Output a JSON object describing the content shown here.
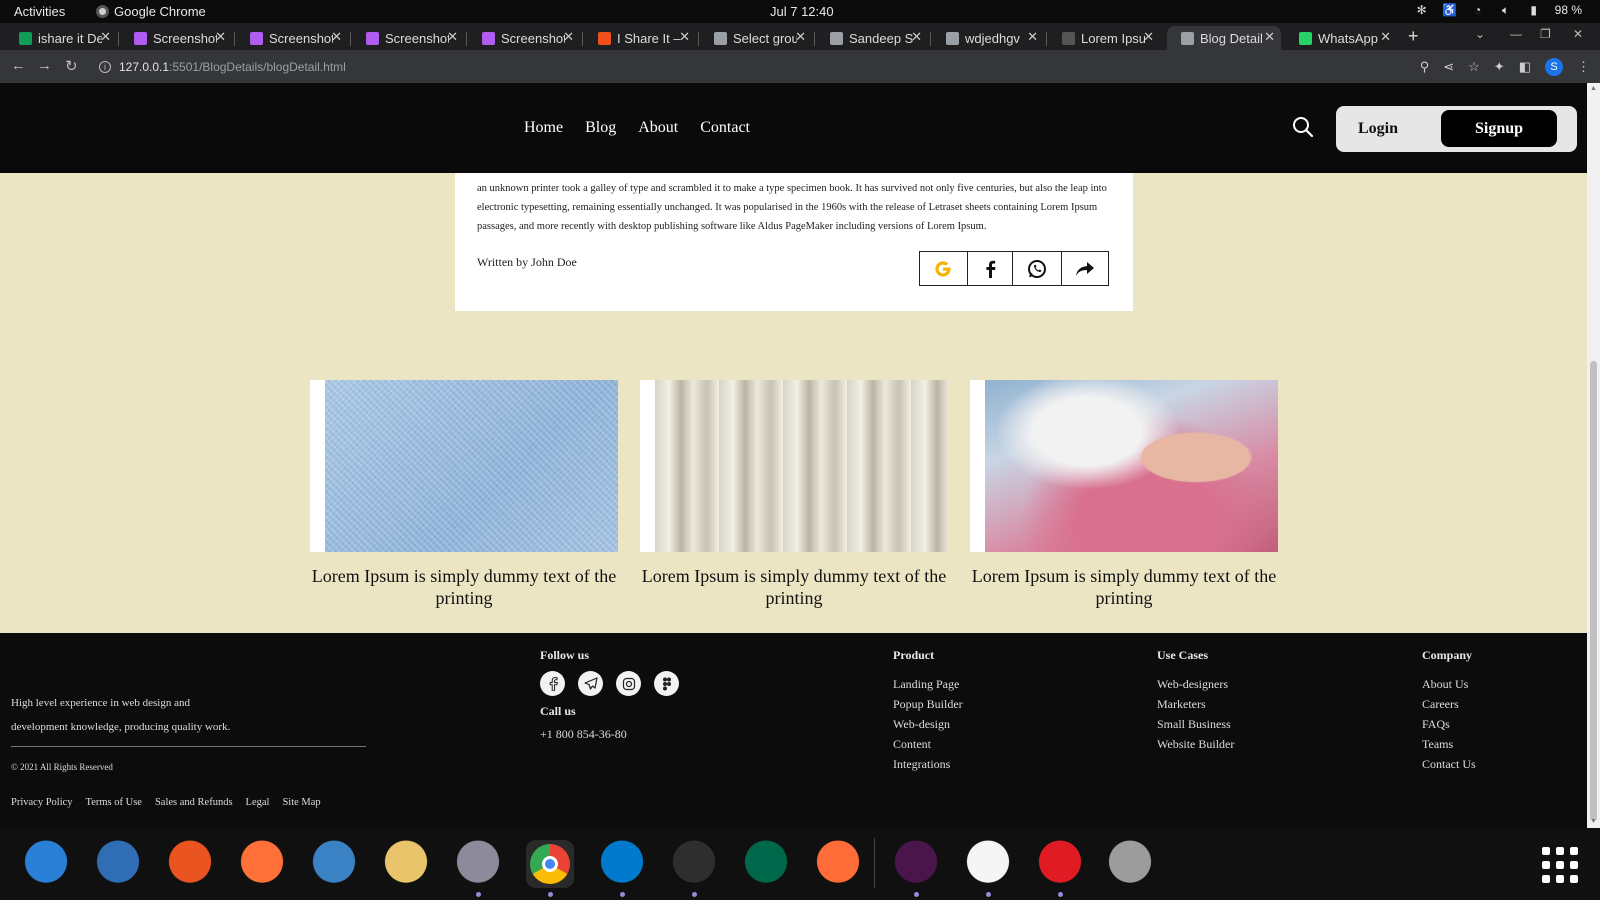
{
  "system_bar": {
    "activities": "Activities",
    "app_name": "Google Chrome",
    "clock": "Jul 7  12:40",
    "battery": "98 %"
  },
  "tabs": [
    {
      "title": "ishare it De",
      "color": "#0f9d58"
    },
    {
      "title": "Screenshot",
      "color": "#b05cf0"
    },
    {
      "title": "Screenshot",
      "color": "#b05cf0"
    },
    {
      "title": "Screenshot",
      "color": "#b05cf0"
    },
    {
      "title": "Screenshot",
      "color": "#b05cf0"
    },
    {
      "title": "I Share It –",
      "color": "#f24e1e"
    },
    {
      "title": "Select grou",
      "color": "#9aa0a6"
    },
    {
      "title": "Sandeep S",
      "color": "#9aa0a6"
    },
    {
      "title": "wdjedhgv",
      "color": "#9aa0a6"
    },
    {
      "title": "Lorem Ipsu",
      "color": "#555555"
    },
    {
      "title": "Blog Detail",
      "color": "#9aa0a6"
    },
    {
      "title": "WhatsApp",
      "color": "#25d366"
    }
  ],
  "active_tab_index": 10,
  "address_bar": {
    "url_host": "127.0.0.1",
    "url_path": ":5501/BlogDetails/blogDetail.html",
    "profile_initial": "S"
  },
  "site_nav": {
    "links": [
      "Home",
      "Blog",
      "About",
      "Contact"
    ],
    "login": "Login",
    "signup": "Signup"
  },
  "article": {
    "body": "an unknown printer took a galley of type and scrambled it to make a type specimen book. It has survived not only five centuries, but also the leap into electronic typesetting, remaining essentially unchanged. It was popularised in the 1960s with the release of Letraset sheets containing Lorem Ipsum passages, and more recently with desktop publishing software like Aldus PageMaker including versions of Lorem Ipsum.",
    "author": "Written by John Doe",
    "share_icons": [
      "google-icon",
      "facebook-icon",
      "whatsapp-icon",
      "share-arrow-icon"
    ]
  },
  "cards": [
    {
      "caption": "Lorem Ipsum is simply dummy text of the printing",
      "image": "denim-fabric"
    },
    {
      "caption": "Lorem Ipsum is simply dummy text of the printing",
      "image": "white-drape-fabric"
    },
    {
      "caption": "Lorem Ipsum is simply dummy text of the printing",
      "image": "sewing-machine"
    }
  ],
  "footer": {
    "about": "High level experience in web design and development knowledge, producing quality work.",
    "copyright": "© 2021 All Rights Reserved",
    "legal_links": [
      "Privacy Policy",
      "Terms of Use",
      "Sales and Refunds",
      "Legal",
      "Site Map"
    ],
    "follow_title": "Follow us",
    "social_icons": [
      "facebook-icon",
      "telegram-icon",
      "instagram-icon",
      "figma-icon"
    ],
    "call_title": "Call us",
    "phone": "+1 800 854-36-80",
    "columns": [
      {
        "title": "Product",
        "items": [
          "Landing Page",
          "Popup Builder",
          "Web-design",
          "Content",
          "Integrations"
        ]
      },
      {
        "title": "Use Cases",
        "items": [
          "Web-designers",
          "Marketers",
          "Small Business",
          "Website Builder"
        ]
      },
      {
        "title": "Company",
        "items": [
          "About Us",
          "Careers",
          "FAQs",
          "Teams",
          "Contact Us"
        ]
      }
    ]
  },
  "dock": [
    {
      "name": "help-app-icon",
      "color": "#2a7fd6",
      "indicator": false
    },
    {
      "name": "writer-app-icon",
      "color": "#2f6db5",
      "indicator": false
    },
    {
      "name": "software-center-app-icon",
      "color": "#e95420",
      "indicator": false
    },
    {
      "name": "firefox-app-icon",
      "color": "#ff7139",
      "indicator": false
    },
    {
      "name": "thunderbird-app-icon",
      "color": "#3b82c4",
      "indicator": false
    },
    {
      "name": "rhythmbox-app-icon",
      "color": "#e9c46a",
      "indicator": false
    },
    {
      "name": "files-app-icon",
      "color": "#8d8a9c",
      "indicator": true
    },
    {
      "name": "chrome-app-icon",
      "color": "#4285f4",
      "indicator": true
    },
    {
      "name": "vscode-app-icon",
      "color": "#007acc",
      "indicator": true
    },
    {
      "name": "terminal-app-icon",
      "color": "#2e2e2e",
      "indicator": true
    },
    {
      "name": "mongodb-compass-app-icon",
      "color": "#00684a",
      "indicator": false
    },
    {
      "name": "postman-app-icon",
      "color": "#ff6c37",
      "indicator": false
    },
    {
      "name": "slack-app-icon",
      "color": "#4a154b",
      "indicator": true
    },
    {
      "name": "text-editor-app-icon",
      "color": "#f5f5f5",
      "indicator": true
    },
    {
      "name": "alert-app-icon",
      "color": "#e01b24",
      "indicator": true
    },
    {
      "name": "trash-app-icon",
      "color": "#9c9c9c",
      "indicator": false
    }
  ]
}
